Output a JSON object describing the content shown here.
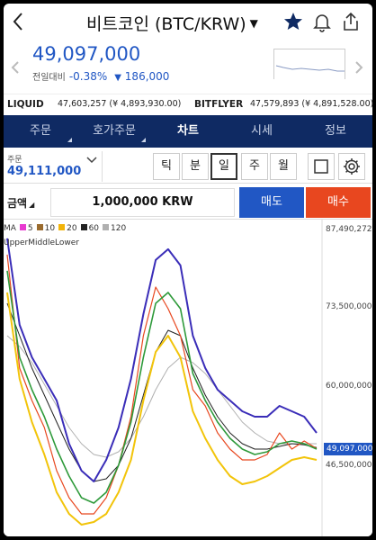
{
  "header": {
    "title": "비트코인 (BTC/KRW)",
    "title_caret": "▼",
    "back_icon": "chevron-left-icon",
    "star_icon": "star-icon",
    "bell_icon": "bell-icon",
    "share_icon": "share-icon"
  },
  "price": {
    "current": "49,097,000",
    "change_label": "전일대비",
    "change_percent": "-0.38%",
    "change_arrow": "▼",
    "change_amount": "186,000",
    "color": "#2157c4"
  },
  "exchanges": [
    {
      "name": "LIQUID",
      "value": "47,603,257 (¥ 4,893,930.00)"
    },
    {
      "name": "BITFLYER",
      "value": "47,579,893 (¥ 4,891,528.00)"
    }
  ],
  "tabs": [
    {
      "label": "주문",
      "has_menu": true
    },
    {
      "label": "호가주문",
      "has_menu": true
    },
    {
      "label": "차트",
      "active": true
    },
    {
      "label": "시세"
    },
    {
      "label": "정보"
    }
  ],
  "order": {
    "label": "주문",
    "value": "49,111,000",
    "dropdown_icon": "chevron-down-icon"
  },
  "intervals": [
    "틱",
    "분",
    "일",
    "주",
    "월"
  ],
  "active_interval": "일",
  "amount": {
    "label": "금액",
    "value": "1,000,000 KRW",
    "sell_label": "매도",
    "buy_label": "매수",
    "sell_color": "#2157c4",
    "buy_color": "#e8471f"
  },
  "chart_data": {
    "type": "line",
    "legend_ma": [
      {
        "name": "MA",
        "color": "#8a8a8a"
      },
      {
        "name": "5",
        "color": "#e83ad0"
      },
      {
        "name": "10",
        "color": "#9a6b2e"
      },
      {
        "name": "20",
        "color": "#f2b40a"
      },
      {
        "name": "60",
        "color": "#222222"
      },
      {
        "name": "120",
        "color": "#b0b0b0"
      }
    ],
    "legend_bb": [
      {
        "name": "Upper",
        "color": "#3a2db8"
      },
      {
        "name": "Middle",
        "color": "#2e9a3a"
      },
      {
        "name": "Lower",
        "color": "#f2c40a"
      }
    ],
    "ytick_labels": [
      "87,490,272",
      "73,500,000",
      "60,000,000",
      "46,500,000"
    ],
    "ytick_values": [
      87490272,
      73500000,
      60000000,
      46500000
    ],
    "current_price_label": "49,097,000",
    "ylim": [
      33500000,
      87490272
    ],
    "upper": [
      88000000,
      72000000,
      66000000,
      62000000,
      58000000,
      50000000,
      45000000,
      43000000,
      47000000,
      53000000,
      62000000,
      74000000,
      84000000,
      86000000,
      83000000,
      70000000,
      64000000,
      60000000,
      58000000,
      56000000,
      55000000,
      55000000,
      57000000,
      56000000,
      55000000,
      52000000
    ],
    "middle": [
      82000000,
      66000000,
      60000000,
      55000000,
      49000000,
      44000000,
      40000000,
      39000000,
      41000000,
      46000000,
      54000000,
      66000000,
      76000000,
      78000000,
      75000000,
      63000000,
      58000000,
      54000000,
      51000000,
      49000000,
      48000000,
      48500000,
      50000000,
      50500000,
      50000000,
      49000000
    ],
    "lower": [
      78000000,
      62000000,
      54000000,
      48000000,
      41000000,
      37000000,
      35000000,
      35500000,
      37000000,
      41000000,
      47000000,
      58000000,
      67000000,
      70000000,
      66000000,
      56000000,
      51000000,
      47000000,
      44000000,
      42500000,
      43000000,
      44000000,
      45500000,
      47000000,
      47500000,
      47000000
    ],
    "ma120": [
      70000000,
      68000000,
      65000000,
      61000000,
      57000000,
      53000000,
      50000000,
      48000000,
      47500000,
      48500000,
      51000000,
      55000000,
      60000000,
      64000000,
      66000000,
      65000000,
      63000000,
      60000000,
      57000000,
      54000000,
      52000000,
      50500000,
      50000000,
      50000000,
      50000000,
      50000000
    ],
    "ma60": [
      76000000,
      70000000,
      64000000,
      59000000,
      54000000,
      49000000,
      45000000,
      43000000,
      43500000,
      46000000,
      51000000,
      59000000,
      67000000,
      71000000,
      70000000,
      64000000,
      59000000,
      55000000,
      52000000,
      50000000,
      49000000,
      49000000,
      49500000,
      50000000,
      49800000,
      49300000
    ],
    "price": [
      85000000,
      64000000,
      58000000,
      53000000,
      45000000,
      40000000,
      37000000,
      37000000,
      40000000,
      46000000,
      55000000,
      70000000,
      79000000,
      75000000,
      70000000,
      60000000,
      57000000,
      52000000,
      49000000,
      47000000,
      47000000,
      48000000,
      52000000,
      49000000,
      50500000,
      49097000
    ]
  }
}
